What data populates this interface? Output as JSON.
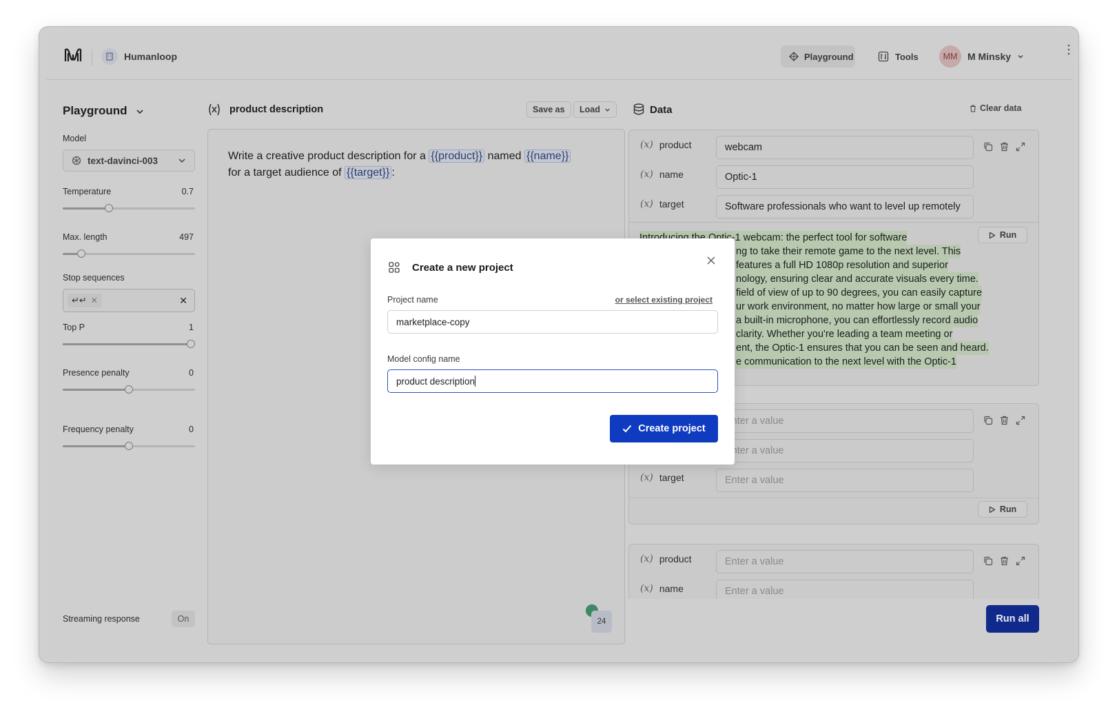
{
  "topbar": {
    "org_name": "Humanloop",
    "nav_playground": "Playground",
    "nav_tools": "Tools",
    "avatar_initials": "MM",
    "user_name": "M Minsky"
  },
  "sidebar": {
    "title": "Playground",
    "model_label": "Model",
    "model_value": "text-davinci-003",
    "sliders": [
      {
        "label": "Temperature",
        "value": "0.7",
        "fraction": 0.35
      },
      {
        "label": "Max. length",
        "value": "497",
        "fraction": 0.14
      },
      {
        "label": "Top P",
        "value": "1",
        "fraction": 1.0
      },
      {
        "label": "Presence penalty",
        "value": "0",
        "fraction": 0.5
      },
      {
        "label": "Frequency penalty",
        "value": "0",
        "fraction": 0.5
      }
    ],
    "stop_label": "Stop sequences",
    "stop_chip": "↵↵",
    "streaming_label": "Streaming response",
    "streaming_value": "On"
  },
  "editor": {
    "config_name": "product description",
    "save_as": "Save as",
    "load": "Load",
    "prompt_line1_a": "Write a creative product description for a",
    "prompt_var_product": "{{product}}",
    "prompt_named": "named",
    "prompt_var_name": "{{name}}",
    "prompt_line2_a": "for a target audience of",
    "prompt_var_target": "{{target}}",
    "prompt_colon": ":",
    "token_count": "24"
  },
  "data_panel": {
    "title": "Data",
    "clear": "Clear data",
    "run_label": "Run",
    "run_all": "Run all",
    "placeholder": "Enter a value",
    "rows": [
      {
        "product": "webcam",
        "name": "Optic-1",
        "target": "Software professionals who want to level up remotely"
      }
    ],
    "var_labels": {
      "product": "product",
      "name": "name",
      "target": "target"
    },
    "output_lines": [
      "Introducing the Optic-1 webcam: the perfect tool for software",
      "ng to take their remote game to the next level. This",
      "features a full HD 1080p resolution and superior",
      "nology, ensuring clear and accurate visuals every time.",
      "field of view of up to 90 degrees, you can easily capture",
      "ur work environment, no matter how large or small your",
      "a built-in microphone, you can effortlessly record audio",
      "clarity. Whether you're leading a team meeting or",
      "ent, the Optic-1 ensures that you can be seen and heard.",
      "e communication to the next level with the Optic-1"
    ]
  },
  "modal": {
    "title": "Create a new project",
    "project_name_label": "Project name",
    "select_existing": "or select existing project",
    "project_name_value": "marketplace-copy",
    "config_name_label": "Model config name",
    "config_name_value": "product description",
    "create_button": "Create project"
  },
  "colors": {
    "accent": "#0f3bc0",
    "overlay_bg": "#cfcfcf",
    "highlight": "#b8c9b0"
  }
}
